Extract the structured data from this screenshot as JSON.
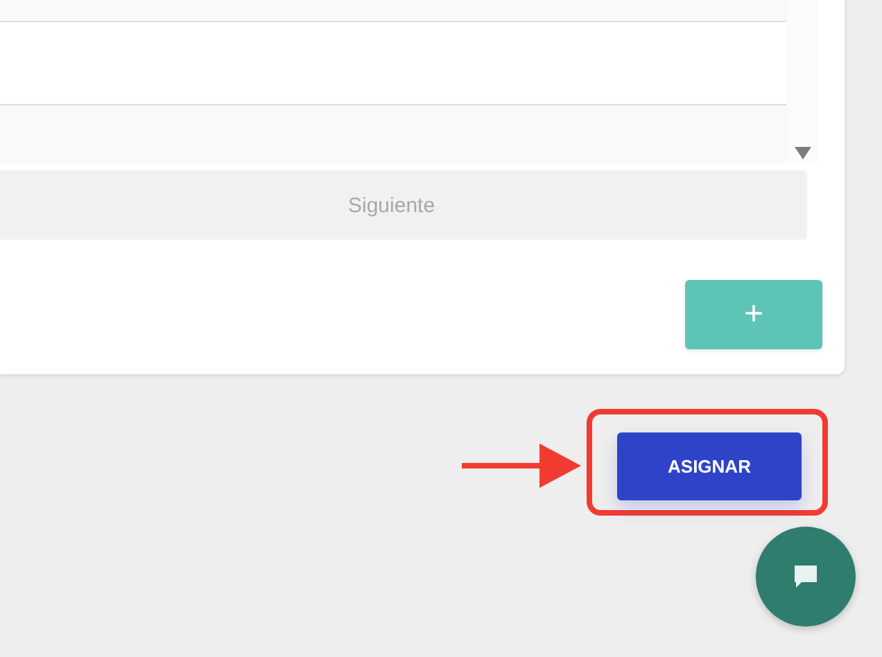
{
  "pagination": {
    "next_label": "Siguiente"
  },
  "add_button": {
    "label": "+"
  },
  "assign_button": {
    "label": "ASIGNAR"
  }
}
